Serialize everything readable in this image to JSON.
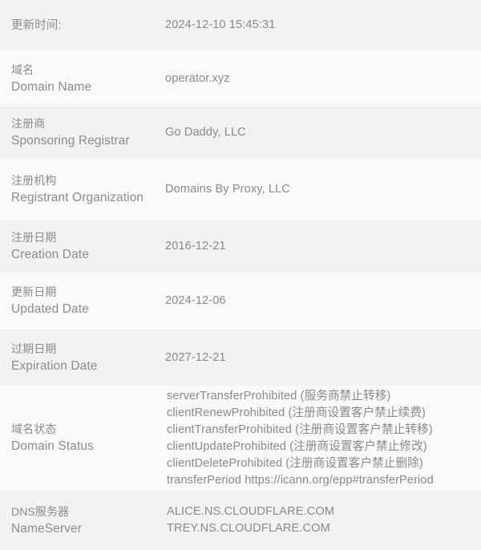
{
  "colors": {
    "row_odd_bg": "#f2f2f2",
    "row_even_bg": "#f9f9f9",
    "label_text": "#8c8c8c",
    "value_text": "#8a8a8a"
  },
  "rows": [
    {
      "label_cn": "更新时间:",
      "label_en": "",
      "value_lines": [
        "2024-12-10 15:45:31"
      ]
    },
    {
      "label_cn": "域名",
      "label_en": "Domain Name",
      "value_lines": [
        "operator.xyz"
      ]
    },
    {
      "label_cn": "注册商",
      "label_en": "Sponsoring Registrar",
      "value_lines": [
        "Go Daddy, LLC"
      ]
    },
    {
      "label_cn": "注册机构",
      "label_en": "Registrant Organization",
      "value_lines": [
        "Domains By Proxy, LLC"
      ]
    },
    {
      "label_cn": "注册日期",
      "label_en": "Creation Date",
      "value_lines": [
        "2016-12-21"
      ]
    },
    {
      "label_cn": "更新日期",
      "label_en": "Updated Date",
      "value_lines": [
        "2024-12-06"
      ]
    },
    {
      "label_cn": "过期日期",
      "label_en": "Expiration Date",
      "value_lines": [
        "2027-12-21"
      ]
    },
    {
      "label_cn": "域名状态",
      "label_en": "Domain Status",
      "value_lines": [
        "serverTransferProhibited (服务商禁止转移)",
        "clientRenewProhibited (注册商设置客户禁止续费)",
        "clientTransferProhibited (注册商设置客户禁止转移)",
        "clientUpdateProhibited (注册商设置客户禁止修改)",
        "clientDeleteProhibited (注册商设置客户禁止删除)",
        "transferPeriod https://icann.org/epp#transferPeriod"
      ]
    },
    {
      "label_cn": "DNS服务器",
      "label_en": "NameServer",
      "value_lines": [
        "ALICE.NS.CLOUDFLARE.COM",
        "TREY.NS.CLOUDFLARE.COM"
      ]
    }
  ]
}
